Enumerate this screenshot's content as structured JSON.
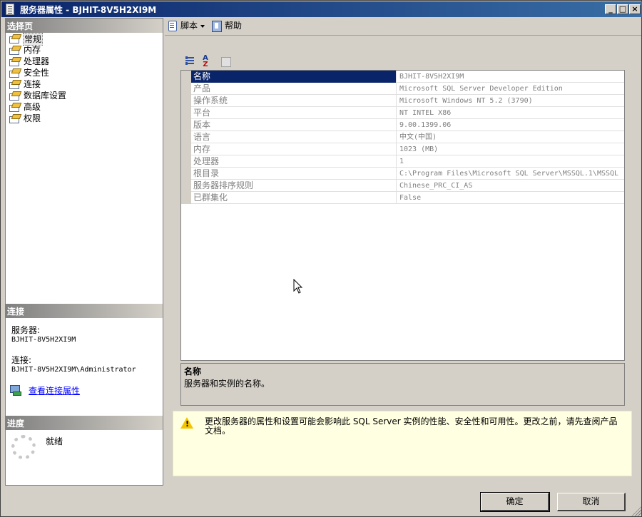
{
  "window": {
    "title": "服务器属性 - BJHIT-8V5H2XI9M"
  },
  "left": {
    "select_page_header": "选择页",
    "pages": [
      {
        "label": "常规",
        "selected": true
      },
      {
        "label": "内存"
      },
      {
        "label": "处理器"
      },
      {
        "label": "安全性"
      },
      {
        "label": "连接"
      },
      {
        "label": "数据库设置"
      },
      {
        "label": "高级"
      },
      {
        "label": "权限"
      }
    ],
    "connection_header": "连接",
    "server_label": "服务器:",
    "server_value": "BJHIT-8V5H2XI9M",
    "connection_label": "连接:",
    "connection_value": "BJHIT-8V5H2XI9M\\Administrator",
    "view_connection_link": "查看连接属性",
    "progress_header": "进度",
    "status": "就绪"
  },
  "toolbar": {
    "script_label": "脚本",
    "help_label": "帮助"
  },
  "properties": [
    {
      "name": "名称",
      "value": "BJHIT-8V5H2XI9M"
    },
    {
      "name": "产品",
      "value": "Microsoft SQL Server Developer Edition"
    },
    {
      "name": "操作系统",
      "value": "Microsoft Windows NT 5.2 (3790)"
    },
    {
      "name": "平台",
      "value": "NT INTEL X86"
    },
    {
      "name": "版本",
      "value": "9.00.1399.06"
    },
    {
      "name": "语言",
      "value": "中文(中国)"
    },
    {
      "name": "内存",
      "value": "1023 (MB)"
    },
    {
      "name": "处理器",
      "value": "1"
    },
    {
      "name": "根目录",
      "value": "C:\\Program Files\\Microsoft SQL Server\\MSSQL.1\\MSSQL"
    },
    {
      "name": "服务器排序规则",
      "value": "Chinese_PRC_CI_AS"
    },
    {
      "name": "已群集化",
      "value": "False"
    }
  ],
  "help": {
    "title": "名称",
    "description": "服务器和实例的名称。"
  },
  "warning": {
    "text": "更改服务器的属性和设置可能会影响此 SQL Server 实例的性能、安全性和可用性。更改之前，请先查阅产品文档。"
  },
  "buttons": {
    "ok": "确定",
    "cancel": "取消"
  }
}
